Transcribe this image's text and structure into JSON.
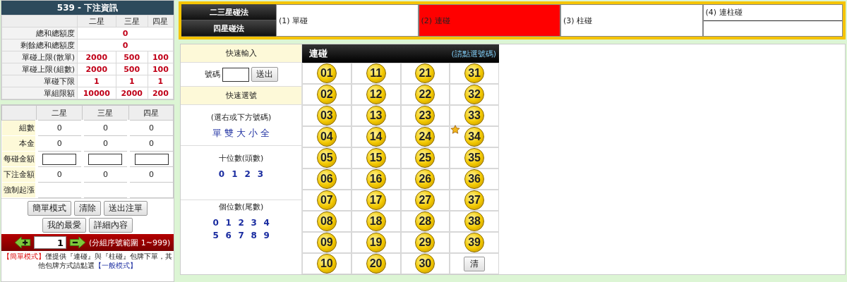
{
  "info_panel": {
    "title": "539 - 下注資訊",
    "columns": [
      "二星",
      "三星",
      "四星"
    ],
    "rows": [
      {
        "label": "總和總額度",
        "values": [
          "0"
        ]
      },
      {
        "label": "剩餘總和總額度",
        "values": [
          "0"
        ]
      },
      {
        "label": "單碰上限(散單)",
        "values": [
          "2000",
          "500",
          "100"
        ]
      },
      {
        "label": "單碰上限(組數)",
        "values": [
          "2000",
          "500",
          "100"
        ]
      },
      {
        "label": "單碰下限",
        "values": [
          "1",
          "1",
          "1"
        ]
      },
      {
        "label": "單組限額",
        "values": [
          "10000",
          "2000",
          "200"
        ]
      }
    ]
  },
  "bet_table": {
    "columns": [
      "二星",
      "三星",
      "四星"
    ],
    "rows": [
      {
        "label": "組數",
        "kind": "value",
        "values": [
          "0",
          "0",
          "0"
        ]
      },
      {
        "label": "本金",
        "kind": "value",
        "values": [
          "0",
          "0",
          "0"
        ]
      },
      {
        "label": "每碰金額",
        "kind": "input"
      },
      {
        "label": "下注金額",
        "kind": "value",
        "values": [
          "0",
          "0",
          "0"
        ]
      },
      {
        "label": "強制起漲",
        "kind": "empty"
      }
    ]
  },
  "button_rows": [
    [
      "簡單模式",
      "清除",
      "送出注單"
    ],
    [
      "我的最愛",
      "詳細內容"
    ]
  ],
  "group_nav": {
    "value": "1",
    "range": "(分組序號範圍 1~999)"
  },
  "note": [
    {
      "kind": "emphasis",
      "text": "【簡單模式】"
    },
    {
      "kind": "plain",
      "text": "僅提供『連碰』與『柱碰』包牌下單，其他包牌方式請點選"
    },
    {
      "kind": "link",
      "text": "【一般模式】"
    }
  ],
  "method_tabs": [
    "二三星碰法",
    "四星碰法"
  ],
  "play_options": [
    {
      "label": "(1) 單碰",
      "selected": false
    },
    {
      "label": "(2) 連碰",
      "selected": true
    },
    {
      "label": "(3) 柱碰",
      "selected": false
    },
    {
      "label": "(4) 連柱碰",
      "selected": false
    }
  ],
  "quick_input": {
    "title": "快速輸入",
    "field_label": "號碼",
    "button": "送出"
  },
  "quick_select": {
    "title": "快速選號",
    "hint": "(選右或下方號碼)",
    "options": [
      "單",
      "雙",
      "大",
      "小",
      "全"
    ]
  },
  "tens": {
    "title": "十位數(頭數)",
    "digits": [
      "0",
      "1",
      "2",
      "3"
    ]
  },
  "units": {
    "title": "個位數(尾數)",
    "digits": [
      "0",
      "1",
      "2",
      "3",
      "4",
      "5",
      "6",
      "7",
      "8",
      "9"
    ]
  },
  "number_grid": {
    "title": "連碰",
    "hint": "(請點選號碼)",
    "clear_button": "清",
    "numbers": [
      {
        "label": "01",
        "starred": false
      },
      {
        "label": "11",
        "starred": false
      },
      {
        "label": "21",
        "starred": false
      },
      {
        "label": "31",
        "starred": false
      },
      {
        "label": "02",
        "starred": false
      },
      {
        "label": "12",
        "starred": false
      },
      {
        "label": "22",
        "starred": false
      },
      {
        "label": "32",
        "starred": false
      },
      {
        "label": "03",
        "starred": false
      },
      {
        "label": "13",
        "starred": false
      },
      {
        "label": "23",
        "starred": false
      },
      {
        "label": "33",
        "starred": false
      },
      {
        "label": "04",
        "starred": false
      },
      {
        "label": "14",
        "starred": false
      },
      {
        "label": "24",
        "starred": false
      },
      {
        "label": "34",
        "starred": true
      },
      {
        "label": "05",
        "starred": false
      },
      {
        "label": "15",
        "starred": false
      },
      {
        "label": "25",
        "starred": false
      },
      {
        "label": "35",
        "starred": false
      },
      {
        "label": "06",
        "starred": false
      },
      {
        "label": "16",
        "starred": false
      },
      {
        "label": "26",
        "starred": false
      },
      {
        "label": "36",
        "starred": false
      },
      {
        "label": "07",
        "starred": false
      },
      {
        "label": "17",
        "starred": false
      },
      {
        "label": "27",
        "starred": false
      },
      {
        "label": "37",
        "starred": false
      },
      {
        "label": "08",
        "starred": false
      },
      {
        "label": "18",
        "starred": false
      },
      {
        "label": "28",
        "starred": false
      },
      {
        "label": "38",
        "starred": false
      },
      {
        "label": "09",
        "starred": false
      },
      {
        "label": "19",
        "starred": false
      },
      {
        "label": "29",
        "starred": false
      },
      {
        "label": "39",
        "starred": false
      },
      {
        "label": "10",
        "starred": false
      },
      {
        "label": "20",
        "starred": false
      },
      {
        "label": "30",
        "starred": false
      }
    ]
  }
}
